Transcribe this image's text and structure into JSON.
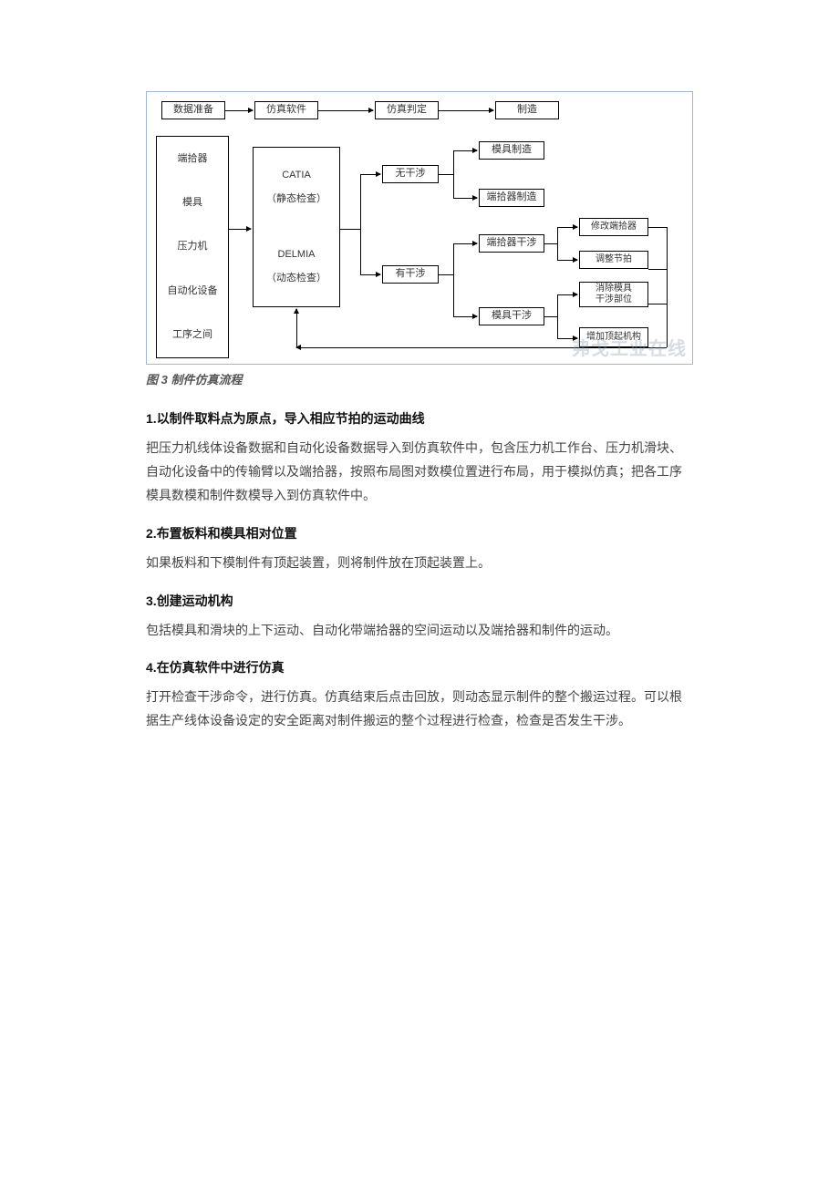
{
  "diagram": {
    "caption": "图 3  制件仿真流程",
    "top_row": [
      "数据准备",
      "仿真软件",
      "仿真判定",
      "制造"
    ],
    "left_inputs": [
      "端拾器",
      "模具",
      "压力机",
      "自动化设备",
      "工序之间"
    ],
    "software": [
      {
        "name": "CATIA",
        "note": "（静态检查）"
      },
      {
        "name": "DELMIA",
        "note": "（动态检查）"
      }
    ],
    "branch_no": "无干涉",
    "branch_yes": "有干涉",
    "outputs_no": [
      "模具制造",
      "端拾器制造"
    ],
    "yes_sub": [
      "端拾器干涉",
      "模具干涉"
    ],
    "leaf_top": [
      "修改端拾器",
      "调整节拍"
    ],
    "leaf_bot": [
      "消除模具\n干涉部位",
      "增加顶起机构"
    ],
    "watermark": "弗戈工业在线"
  },
  "sections": [
    {
      "num": "1.",
      "title": "以制件取料点为原点，导入相应节拍的运动曲线",
      "body": "把压力机线体设备数据和自动化设备数据导入到仿真软件中，包含压力机工作台、压力机滑块、自动化设备中的传输臂以及端拾器，按照布局图对数模位置进行布局，用于模拟仿真；把各工序模具数模和制件数模导入到仿真软件中。"
    },
    {
      "num": "2.",
      "title": "布置板料和模具相对位置",
      "body": "如果板料和下模制件有顶起装置，则将制件放在顶起装置上。"
    },
    {
      "num": "3.",
      "title": "创建运动机构",
      "body": "包括模具和滑块的上下运动、自动化带端拾器的空间运动以及端拾器和制件的运动。"
    },
    {
      "num": "4.",
      "title": "在仿真软件中进行仿真",
      "body": "打开检查干涉命令，进行仿真。仿真结束后点击回放，则动态显示制件的整个搬运过程。可以根据生产线体设备设定的安全距离对制件搬运的整个过程进行检查，检查是否发生干涉。"
    }
  ]
}
